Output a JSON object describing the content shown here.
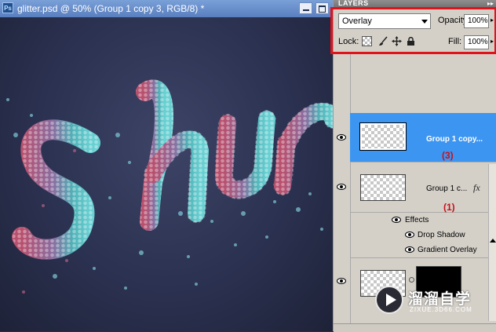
{
  "document": {
    "app_icon": "Ps",
    "title": "glitter.psd @ 50% (Group 1 copy 3, RGB/8) *"
  },
  "layers_panel": {
    "title": "LAYERS",
    "blend_mode": "Overlay",
    "opacity_label": "Opacity:",
    "opacity_value": "100%",
    "lock_label": "Lock:",
    "fill_label": "Fill:",
    "fill_value": "100%",
    "lock_icons": [
      "lock-transparent-icon",
      "brush-icon",
      "move-icon",
      "padlock-icon"
    ],
    "layers": [
      {
        "name": "Group 1 copy...",
        "annotation": "(3)",
        "selected": true,
        "visible": true
      },
      {
        "name": "Group 1 c...",
        "annotation": "(1)",
        "selected": false,
        "visible": true,
        "has_fx": true,
        "fx_label": "fx"
      },
      {
        "name": "",
        "selected": false,
        "visible": true,
        "has_mask": true
      }
    ],
    "effects_label": "Effects",
    "effects": [
      "Drop Shadow",
      "Gradient Overlay"
    ]
  },
  "watermark": {
    "text": "溜溜自学",
    "url": "ZIXUE.3D66.COM"
  },
  "colors": {
    "selection": "#3c95f1",
    "highlight_box": "#e2121b",
    "annotation": "#c8101a"
  }
}
